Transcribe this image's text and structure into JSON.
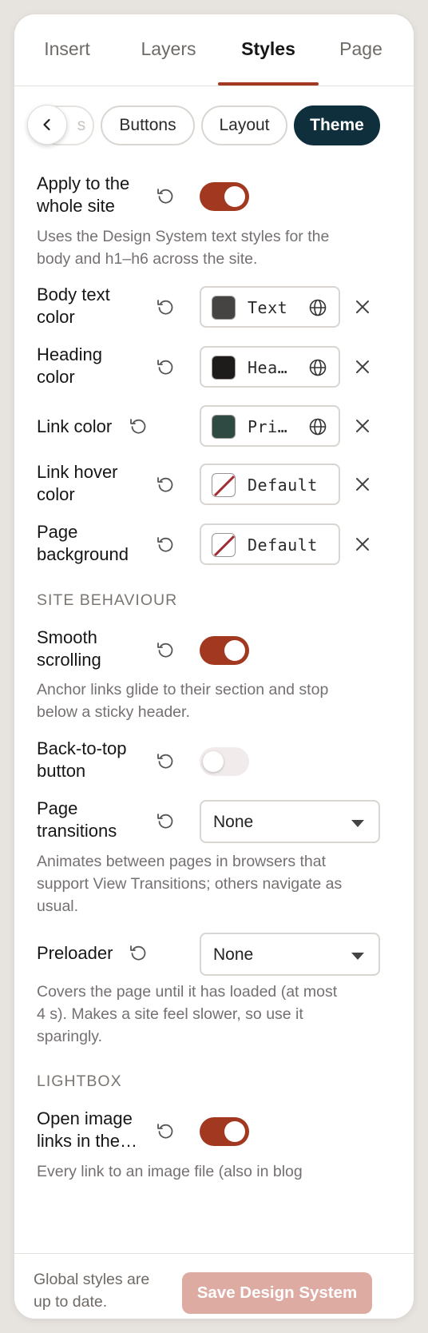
{
  "tabs": [
    "Insert",
    "Layers",
    "Styles",
    "Page"
  ],
  "subtabs": {
    "partial": "s",
    "buttons": "Buttons",
    "layout": "Layout",
    "theme": "Theme"
  },
  "apply_site": {
    "label_1": "Apply to the",
    "label_2": "whole site",
    "on": true,
    "desc_1": "Uses the Design System text styles for the",
    "desc_2": "body and h1–h6 across the site."
  },
  "colors": {
    "body_text": {
      "label_1": "Body text",
      "label_2": "color",
      "value": "Text",
      "swatch": "#454442"
    },
    "heading": {
      "label_1": "Heading",
      "label_2": "color",
      "value": "Hea…",
      "swatch": "#1d1c1b"
    },
    "link": {
      "label": "Link color",
      "value": "Pri…",
      "swatch": "#2e4a42"
    },
    "link_hover": {
      "label_1": "Link hover",
      "label_2": "color",
      "value": "Default"
    },
    "page_bg": {
      "label_1": "Page",
      "label_2": "background",
      "value": "Default"
    }
  },
  "site_behaviour": {
    "title": "SITE BEHAVIOUR",
    "smooth": {
      "label_1": "Smooth",
      "label_2": "scrolling",
      "on": true,
      "desc_1": "Anchor links glide to their section and stop",
      "desc_2": "below a sticky header."
    },
    "back_to_top": {
      "label_1": "Back-to-top",
      "label_2": "button",
      "on": false
    },
    "transitions": {
      "label_1": "Page",
      "label_2": "transitions",
      "value": "None",
      "desc_1": "Animates between pages in browsers that",
      "desc_2": "support View Transitions; others navigate as",
      "desc_3": "usual."
    },
    "preloader": {
      "label": "Preloader",
      "value": "None",
      "desc_1": "Covers the page until it has loaded (at most",
      "desc_2": "4 s). Makes a site feel slower, so use it",
      "desc_3": "sparingly."
    }
  },
  "lightbox": {
    "title": "LIGHTBOX",
    "open_links": {
      "label_1": "Open image",
      "label_2": "links in the…",
      "on": true,
      "desc_1": "Every link to an image file (also in blog"
    }
  },
  "footer": {
    "status_1": "Global styles are",
    "status_2": "up to date.",
    "save": "Save Design System"
  },
  "colors_theme": {
    "accent": "#a2381f",
    "dark": "#0f2f3c",
    "save_disabled": "#ddaba2"
  }
}
